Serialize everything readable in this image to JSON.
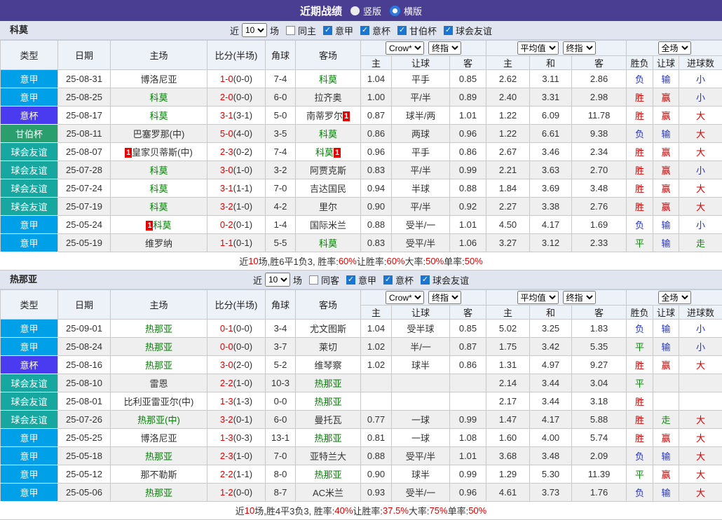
{
  "title_bar": {
    "title": "近期战绩",
    "vertical_label": "竖版",
    "horizontal_label": "横版",
    "selected": "横版"
  },
  "filter_labels": {
    "near": "近",
    "games": "场"
  },
  "header": {
    "type": "类型",
    "date": "日期",
    "home": "主场",
    "score": "比分(半场)",
    "corner": "角球",
    "away": "客场",
    "odds_source": "Crow*",
    "odds_final": "终指",
    "avg_source": "平均值",
    "avg_final": "终指",
    "fulltime": "全场",
    "sub_odds": [
      "主",
      "让球",
      "客"
    ],
    "sub_avg": [
      "主",
      "和",
      "客"
    ],
    "sub_result": [
      "胜负",
      "让球",
      "进球数"
    ]
  },
  "colors": {
    "league": {
      "意甲": "#00a0e9",
      "意杯": "#4b3bf0",
      "甘伯杯": "#2b9e6e",
      "球会友谊": "#16a8a0"
    },
    "result": {
      "red": "#d20000",
      "blue": "#2433cc",
      "green": "#0a8a0a"
    },
    "focus_team": "#008000",
    "score": "#e60000",
    "titlebar": "#4a3e92",
    "badge": "#e60000"
  },
  "sections": [
    {
      "team": "科莫",
      "filter": {
        "count": "10",
        "same_label": "同主",
        "same_checked": false,
        "leagues": [
          "意甲",
          "意杯",
          "甘伯杯",
          "球会友谊"
        ]
      },
      "rows": [
        {
          "league": "意甲",
          "date": "25-08-31",
          "home": {
            "name": "博洛尼亚"
          },
          "score": "1-0",
          "half": "(0-0)",
          "corner": "7-4",
          "away": {
            "name": "科莫",
            "focus": true
          },
          "odds": [
            "1.04",
            "平手",
            "0.85"
          ],
          "avg": [
            "2.62",
            "3.11",
            "2.86"
          ],
          "result": [
            [
              "负",
              "blue"
            ],
            [
              "输",
              "blue"
            ],
            [
              "小",
              "blue"
            ]
          ]
        },
        {
          "league": "意甲",
          "date": "25-08-25",
          "home": {
            "name": "科莫",
            "focus": true
          },
          "score": "2-0",
          "half": "(0-0)",
          "corner": "6-0",
          "away": {
            "name": "拉齐奥"
          },
          "odds": [
            "1.00",
            "平/半",
            "0.89"
          ],
          "avg": [
            "2.40",
            "3.31",
            "2.98"
          ],
          "result": [
            [
              "胜",
              "red"
            ],
            [
              "赢",
              "red"
            ],
            [
              "小",
              "blue"
            ]
          ]
        },
        {
          "league": "意杯",
          "date": "25-08-17",
          "home": {
            "name": "科莫",
            "focus": true
          },
          "score": "3-1",
          "half": "(3-1)",
          "corner": "5-0",
          "away": {
            "name": "南蒂罗尔",
            "badge": "after"
          },
          "odds": [
            "0.87",
            "球半/两",
            "1.01"
          ],
          "avg": [
            "1.22",
            "6.09",
            "11.78"
          ],
          "result": [
            [
              "胜",
              "red"
            ],
            [
              "赢",
              "red"
            ],
            [
              "大",
              "red"
            ]
          ]
        },
        {
          "league": "甘伯杯",
          "date": "25-08-11",
          "home": {
            "name": "巴塞罗那(中)"
          },
          "score": "5-0",
          "half": "(4-0)",
          "corner": "3-5",
          "away": {
            "name": "科莫",
            "focus": true
          },
          "odds": [
            "0.86",
            "两球",
            "0.96"
          ],
          "avg": [
            "1.22",
            "6.61",
            "9.38"
          ],
          "result": [
            [
              "负",
              "blue"
            ],
            [
              "输",
              "blue"
            ],
            [
              "大",
              "red"
            ]
          ]
        },
        {
          "league": "球会友谊",
          "date": "25-08-07",
          "home": {
            "name": "皇家贝蒂斯(中)",
            "badge": "before"
          },
          "score": "2-3",
          "half": "(0-2)",
          "corner": "7-4",
          "away": {
            "name": "科莫",
            "focus": true,
            "badge": "after"
          },
          "odds": [
            "0.96",
            "平手",
            "0.86"
          ],
          "avg": [
            "2.67",
            "3.46",
            "2.34"
          ],
          "result": [
            [
              "胜",
              "red"
            ],
            [
              "赢",
              "red"
            ],
            [
              "大",
              "red"
            ]
          ]
        },
        {
          "league": "球会友谊",
          "date": "25-07-28",
          "home": {
            "name": "科莫",
            "focus": true
          },
          "score": "3-0",
          "half": "(1-0)",
          "corner": "3-2",
          "away": {
            "name": "阿贾克斯"
          },
          "odds": [
            "0.83",
            "平/半",
            "0.99"
          ],
          "avg": [
            "2.21",
            "3.63",
            "2.70"
          ],
          "result": [
            [
              "胜",
              "red"
            ],
            [
              "赢",
              "red"
            ],
            [
              "小",
              "blue"
            ]
          ]
        },
        {
          "league": "球会友谊",
          "date": "25-07-24",
          "home": {
            "name": "科莫",
            "focus": true
          },
          "score": "3-1",
          "half": "(1-1)",
          "corner": "7-0",
          "away": {
            "name": "吉达国民"
          },
          "odds": [
            "0.94",
            "半球",
            "0.88"
          ],
          "avg": [
            "1.84",
            "3.69",
            "3.48"
          ],
          "result": [
            [
              "胜",
              "red"
            ],
            [
              "赢",
              "red"
            ],
            [
              "大",
              "red"
            ]
          ]
        },
        {
          "league": "球会友谊",
          "date": "25-07-19",
          "home": {
            "name": "科莫",
            "focus": true
          },
          "score": "3-2",
          "half": "(1-0)",
          "corner": "4-2",
          "away": {
            "name": "里尔"
          },
          "odds": [
            "0.90",
            "平/半",
            "0.92"
          ],
          "avg": [
            "2.27",
            "3.38",
            "2.76"
          ],
          "result": [
            [
              "胜",
              "red"
            ],
            [
              "赢",
              "red"
            ],
            [
              "大",
              "red"
            ]
          ]
        },
        {
          "league": "意甲",
          "date": "25-05-24",
          "home": {
            "name": "科莫",
            "focus": true,
            "badge": "before"
          },
          "score": "0-2",
          "half": "(0-1)",
          "corner": "1-4",
          "away": {
            "name": "国际米兰"
          },
          "odds": [
            "0.88",
            "受半/一",
            "1.01"
          ],
          "avg": [
            "4.50",
            "4.17",
            "1.69"
          ],
          "result": [
            [
              "负",
              "blue"
            ],
            [
              "输",
              "blue"
            ],
            [
              "小",
              "blue"
            ]
          ]
        },
        {
          "league": "意甲",
          "date": "25-05-19",
          "home": {
            "name": "维罗纳"
          },
          "score": "1-1",
          "half": "(0-1)",
          "corner": "5-5",
          "away": {
            "name": "科莫",
            "focus": true
          },
          "odds": [
            "0.83",
            "受平/半",
            "1.06"
          ],
          "avg": [
            "3.27",
            "3.12",
            "2.33"
          ],
          "result": [
            [
              "平",
              "green"
            ],
            [
              "输",
              "blue"
            ],
            [
              "走",
              "green"
            ]
          ]
        }
      ],
      "summary": [
        [
          "近",
          "d"
        ],
        [
          "10",
          "r"
        ],
        [
          "场,胜6平1负3, 胜率:",
          "d"
        ],
        [
          "60%",
          "r"
        ],
        [
          " 让胜率:",
          "d"
        ],
        [
          "60%",
          "r"
        ],
        [
          " 大率:",
          "d"
        ],
        [
          "50%",
          "r"
        ],
        [
          " 单率:",
          "d"
        ],
        [
          "50%",
          "r"
        ]
      ]
    },
    {
      "team": "热那亚",
      "filter": {
        "count": "10",
        "same_label": "同客",
        "same_checked": false,
        "leagues": [
          "意甲",
          "意杯",
          "球会友谊"
        ]
      },
      "rows": [
        {
          "league": "意甲",
          "date": "25-09-01",
          "home": {
            "name": "热那亚",
            "focus": true
          },
          "score": "0-1",
          "half": "(0-0)",
          "corner": "3-4",
          "away": {
            "name": "尤文图斯"
          },
          "odds": [
            "1.04",
            "受半球",
            "0.85"
          ],
          "avg": [
            "5.02",
            "3.25",
            "1.83"
          ],
          "result": [
            [
              "负",
              "blue"
            ],
            [
              "输",
              "blue"
            ],
            [
              "小",
              "blue"
            ]
          ]
        },
        {
          "league": "意甲",
          "date": "25-08-24",
          "home": {
            "name": "热那亚",
            "focus": true
          },
          "score": "0-0",
          "half": "(0-0)",
          "corner": "3-7",
          "away": {
            "name": "莱切"
          },
          "odds": [
            "1.02",
            "半/一",
            "0.87"
          ],
          "avg": [
            "1.75",
            "3.42",
            "5.35"
          ],
          "result": [
            [
              "平",
              "green"
            ],
            [
              "输",
              "blue"
            ],
            [
              "小",
              "blue"
            ]
          ]
        },
        {
          "league": "意杯",
          "date": "25-08-16",
          "home": {
            "name": "热那亚",
            "focus": true
          },
          "score": "3-0",
          "half": "(2-0)",
          "corner": "5-2",
          "away": {
            "name": "维琴察"
          },
          "odds": [
            "1.02",
            "球半",
            "0.86"
          ],
          "avg": [
            "1.31",
            "4.97",
            "9.27"
          ],
          "result": [
            [
              "胜",
              "red"
            ],
            [
              "赢",
              "red"
            ],
            [
              "大",
              "red"
            ]
          ]
        },
        {
          "league": "球会友谊",
          "date": "25-08-10",
          "home": {
            "name": "雷恩"
          },
          "score": "2-2",
          "half": "(1-0)",
          "corner": "10-3",
          "away": {
            "name": "热那亚",
            "focus": true
          },
          "odds": [
            "",
            "",
            ""
          ],
          "avg": [
            "2.14",
            "3.44",
            "3.04"
          ],
          "result": [
            [
              "平",
              "green"
            ],
            [
              "",
              "blue"
            ],
            [
              "",
              "blue"
            ]
          ]
        },
        {
          "league": "球会友谊",
          "date": "25-08-01",
          "home": {
            "name": "比利亚雷亚尔(中)"
          },
          "score": "1-3",
          "half": "(1-3)",
          "corner": "0-0",
          "away": {
            "name": "热那亚",
            "focus": true
          },
          "odds": [
            "",
            "",
            ""
          ],
          "avg": [
            "2.17",
            "3.44",
            "3.18"
          ],
          "result": [
            [
              "胜",
              "red"
            ],
            [
              "",
              "blue"
            ],
            [
              "",
              "blue"
            ]
          ]
        },
        {
          "league": "球会友谊",
          "date": "25-07-26",
          "home": {
            "name": "热那亚(中)",
            "focus": true
          },
          "score": "3-2",
          "half": "(0-1)",
          "corner": "6-0",
          "away": {
            "name": "曼托瓦"
          },
          "odds": [
            "0.77",
            "一球",
            "0.99"
          ],
          "avg": [
            "1.47",
            "4.17",
            "5.88"
          ],
          "result": [
            [
              "胜",
              "red"
            ],
            [
              "走",
              "green"
            ],
            [
              "大",
              "red"
            ]
          ]
        },
        {
          "league": "意甲",
          "date": "25-05-25",
          "home": {
            "name": "博洛尼亚"
          },
          "score": "1-3",
          "half": "(0-3)",
          "corner": "13-1",
          "away": {
            "name": "热那亚",
            "focus": true
          },
          "odds": [
            "0.81",
            "一球",
            "1.08"
          ],
          "avg": [
            "1.60",
            "4.00",
            "5.74"
          ],
          "result": [
            [
              "胜",
              "red"
            ],
            [
              "赢",
              "red"
            ],
            [
              "大",
              "red"
            ]
          ]
        },
        {
          "league": "意甲",
          "date": "25-05-18",
          "home": {
            "name": "热那亚",
            "focus": true
          },
          "score": "2-3",
          "half": "(1-0)",
          "corner": "7-0",
          "away": {
            "name": "亚特兰大"
          },
          "odds": [
            "0.88",
            "受平/半",
            "1.01"
          ],
          "avg": [
            "3.68",
            "3.48",
            "2.09"
          ],
          "result": [
            [
              "负",
              "blue"
            ],
            [
              "输",
              "blue"
            ],
            [
              "大",
              "red"
            ]
          ]
        },
        {
          "league": "意甲",
          "date": "25-05-12",
          "home": {
            "name": "那不勒斯"
          },
          "score": "2-2",
          "half": "(1-1)",
          "corner": "8-0",
          "away": {
            "name": "热那亚",
            "focus": true
          },
          "odds": [
            "0.90",
            "球半",
            "0.99"
          ],
          "avg": [
            "1.29",
            "5.30",
            "11.39"
          ],
          "result": [
            [
              "平",
              "green"
            ],
            [
              "赢",
              "red"
            ],
            [
              "大",
              "red"
            ]
          ]
        },
        {
          "league": "意甲",
          "date": "25-05-06",
          "home": {
            "name": "热那亚",
            "focus": true
          },
          "score": "1-2",
          "half": "(0-0)",
          "corner": "8-7",
          "away": {
            "name": "AC米兰"
          },
          "odds": [
            "0.93",
            "受半/一",
            "0.96"
          ],
          "avg": [
            "4.61",
            "3.73",
            "1.76"
          ],
          "result": [
            [
              "负",
              "blue"
            ],
            [
              "输",
              "blue"
            ],
            [
              "大",
              "red"
            ]
          ]
        }
      ],
      "summary": [
        [
          "近",
          "d"
        ],
        [
          "10",
          "r"
        ],
        [
          "场,胜4平3负3, 胜率:",
          "d"
        ],
        [
          "40%",
          "r"
        ],
        [
          " 让胜率:",
          "d"
        ],
        [
          "37.5%",
          "r"
        ],
        [
          " 大率:",
          "d"
        ],
        [
          "75%",
          "r"
        ],
        [
          " 单率:",
          "d"
        ],
        [
          "50%",
          "r"
        ]
      ]
    }
  ]
}
